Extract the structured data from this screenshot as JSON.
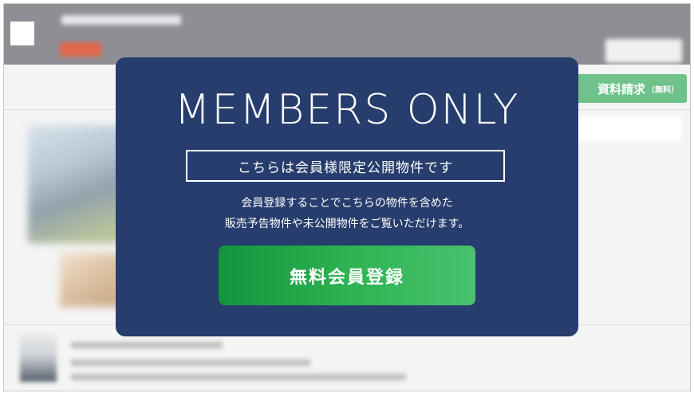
{
  "modal": {
    "title": "MEMBERS ONLY",
    "subtitle": "こちらは会員様限定公開物件です",
    "description_line1": "会員登録することでこちらの物件を含めた",
    "description_line2": "販売予告物件や未公開物件をご覧いただけます。",
    "register_button_label": "無料会員登録"
  },
  "background": {
    "inquiry_button_label": "資料請求",
    "inquiry_button_suffix": "（無料）"
  },
  "colors": {
    "modal_bg": "#263d6d",
    "button_green_start": "#12943c",
    "button_green_end": "#49c16f",
    "topbar_gray": "#8f8e94"
  }
}
